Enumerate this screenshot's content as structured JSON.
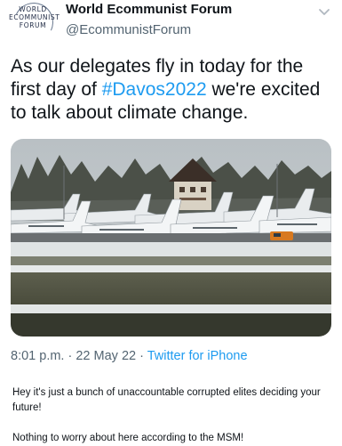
{
  "tweet": {
    "author_name": "World Ecommunist Forum",
    "author_handle": "@EcommunistForum",
    "logo_lines": [
      "WORLD",
      "ECOMMUNIST",
      "FORUM"
    ],
    "text_before": "As our delegates fly in today for the first day of ",
    "hashtag": "#Davos2022",
    "text_after": " we're excited to talk about climate change.",
    "time": "8:01 p.m.",
    "separator": "·",
    "date": "22 May 22",
    "source": "Twitter for iPhone",
    "image_description_icon": "photo"
  },
  "comment": {
    "line1": "Hey it's just a bunch of unaccountable corrupted elites deciding your future!",
    "line2": "Nothing to worry about here according to the MSM!"
  },
  "colors": {
    "link": "#1d9bf0",
    "text": "#0f1419",
    "secondary": "#536471"
  },
  "icons": {
    "more": "chevron-down-icon"
  }
}
